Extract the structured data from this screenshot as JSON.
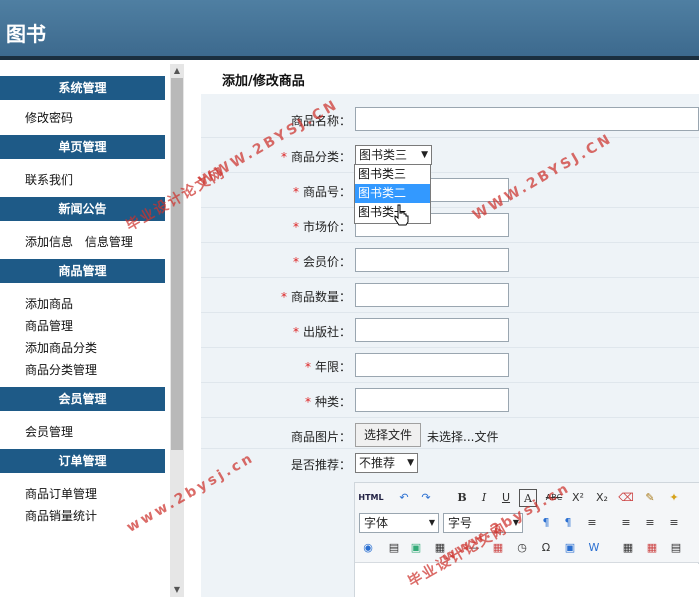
{
  "app": {
    "title": "图书"
  },
  "sidebar": {
    "sections": [
      {
        "header": "系统管理",
        "links": [
          "修改密码"
        ]
      },
      {
        "header": "单页管理",
        "links": [
          "联系我们"
        ]
      },
      {
        "header": "新闻公告",
        "links": [
          "添加信息",
          "信息管理"
        ]
      },
      {
        "header": "商品管理",
        "links": [
          "添加商品",
          "商品管理",
          "添加商品分类",
          "商品分类管理"
        ]
      },
      {
        "header": "会员管理",
        "links": [
          "会员管理"
        ]
      },
      {
        "header": "订单管理",
        "links": [
          "商品订单管理",
          "商品销量统计"
        ]
      }
    ]
  },
  "form": {
    "page_title": "添加/修改商品",
    "required_mark": "*",
    "fields": {
      "name": {
        "label": "商品名称：",
        "value": ""
      },
      "category": {
        "label": "商品分类：",
        "value": "图书类三"
      },
      "code": {
        "label": "商品号：",
        "value": ""
      },
      "market_price": {
        "label": "市场价：",
        "value": ""
      },
      "member_price": {
        "label": "会员价：",
        "value": ""
      },
      "quantity": {
        "label": "商品数量：",
        "value": ""
      },
      "publisher": {
        "label": "出版社：",
        "value": ""
      },
      "year": {
        "label": "年限：",
        "value": ""
      },
      "kind": {
        "label": "种类：",
        "value": ""
      },
      "image": {
        "label": "商品图片：",
        "button": "选择文件",
        "status": "未选择...文件"
      },
      "recommend": {
        "label": "是否推荐：",
        "value": "不推荐"
      }
    },
    "category_dropdown": {
      "options": [
        "图书类三",
        "图书类二",
        "图书类一"
      ],
      "highlighted": "图书类二"
    }
  },
  "editor": {
    "html_button": "HTML",
    "font_family": "字体",
    "font_size": "字号",
    "bold": "B",
    "italic": "I",
    "underline": "U",
    "font_color": "A",
    "strike": "ABC",
    "superscript": "X²",
    "subscript": "X₂",
    "special_char": "Ω"
  },
  "watermarks": {
    "site": "WWW.2BYSJ.CN",
    "site_lower": "www.2bysj.cn",
    "label": "毕业设计论文网"
  },
  "colors": {
    "topbar": "#3d6a8e",
    "menu_header": "#1e5a87",
    "form_panel": "#eef3f7",
    "required": "#dd2222",
    "selected_option": "#3399ff",
    "watermark": "#cd322d"
  }
}
